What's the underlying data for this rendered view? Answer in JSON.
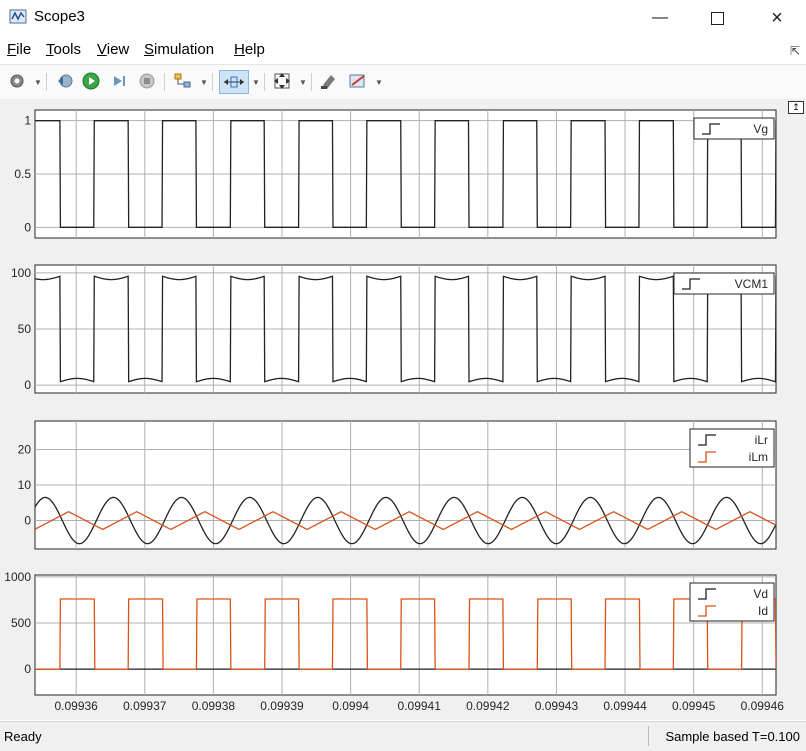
{
  "window": {
    "title": "Scope3",
    "icons": {
      "app": "scope-icon",
      "minimize": "minimize-icon",
      "maximize": "maximize-icon",
      "close": "close-icon"
    }
  },
  "menu": {
    "items": [
      "File",
      "Tools",
      "View",
      "Simulation",
      "Help"
    ]
  },
  "toolbar": {
    "buttons": [
      "settings-icon",
      "step-back-icon",
      "run-icon",
      "step-forward-icon",
      "stop-icon",
      "signal-selector-icon",
      "zoom-time-icon",
      "autoscale-icon",
      "style-icon",
      "measurement-icon"
    ]
  },
  "status": {
    "left": "Ready",
    "right": "Sample based T=0.100"
  },
  "colors": {
    "black_series": "#222222",
    "orange_series": "#d95319",
    "grid": "#b0b0b0"
  },
  "chart_data": [
    {
      "type": "line",
      "xlim": [
        0.099354,
        0.099462
      ],
      "ylim": [
        -0.1,
        1.1
      ],
      "yticks": [
        "1",
        "0.5",
        "0"
      ],
      "grid": true,
      "legend_position": "top-right",
      "series": [
        {
          "name": "Vg",
          "color": "#222222",
          "period_s": 9.93e-06,
          "shape": "square",
          "high": 1,
          "low": 0,
          "high_fraction": 0.5,
          "first_rising_edge": 0.0993527
        }
      ]
    },
    {
      "type": "line",
      "xlim": [
        0.099354,
        0.099462
      ],
      "ylim": [
        -7,
        107
      ],
      "yticks": [
        "100",
        "50",
        "0"
      ],
      "grid": true,
      "legend_position": "top-right",
      "series": [
        {
          "name": "VCM1",
          "color": "#222222",
          "period_s": 9.93e-06,
          "shape": "square-with-ripple",
          "high": 97,
          "low": 3,
          "ripple": 3,
          "high_fraction": 0.5,
          "first_rising_edge": 0.0993527
        }
      ]
    },
    {
      "type": "line",
      "xlim": [
        0.099354,
        0.099462
      ],
      "ylim": [
        -8,
        28
      ],
      "yticks": [
        "20",
        "10",
        "0"
      ],
      "grid": true,
      "legend_position": "top-right",
      "series": [
        {
          "name": "iLr",
          "color": "#222222",
          "period_s": 9.93e-06,
          "shape": "sine",
          "amplitude": 6.5,
          "offset": 0,
          "peak_time": 0.0993555
        },
        {
          "name": "iLm",
          "color": "#d95319",
          "period_s": 9.93e-06,
          "shape": "triangle",
          "amplitude": 2.5,
          "offset": 0,
          "peak_time": 0.0993589
        }
      ]
    },
    {
      "type": "line",
      "xlim": [
        0.099354,
        0.099462
      ],
      "ylim": [
        -280,
        1020
      ],
      "yticks": [
        "1000",
        "500",
        "0"
      ],
      "xticks": [
        "0.09936",
        "0.09937",
        "0.09938",
        "0.09939",
        "0.0994",
        "0.09941",
        "0.09942",
        "0.09943",
        "0.09944",
        "0.09945",
        "0.09946"
      ],
      "xtick_values": [
        0.09936,
        0.09937,
        0.09938,
        0.09939,
        0.0994,
        0.09941,
        0.09942,
        0.09943,
        0.09944,
        0.09945,
        0.09946
      ],
      "grid": true,
      "legend_position": "top-right",
      "series": [
        {
          "name": "Vd",
          "color": "#222222",
          "shape": "flat",
          "value": 0
        },
        {
          "name": "Id",
          "color": "#d95319",
          "period_s": 9.93e-06,
          "shape": "square",
          "high": 760,
          "low": 0,
          "high_fraction": 0.5,
          "first_rising_edge": 0.0993577
        }
      ]
    }
  ]
}
